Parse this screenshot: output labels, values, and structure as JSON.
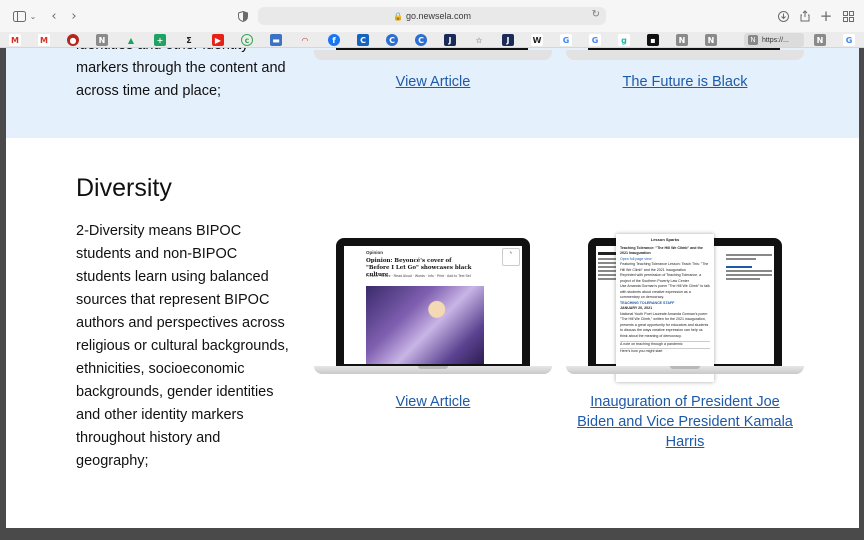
{
  "browser": {
    "url": "go.newsela.com",
    "active_tab_label": "https://..."
  },
  "band": {
    "text": "identities and other identity markers through the content and across time and place;",
    "link_left": "View Article",
    "link_right": "The Future is Black"
  },
  "diversity": {
    "heading": "Diversity",
    "body": "2-Diversity means BIPOC students and non-BIPOC students learn using balanced sources that represent BIPOC authors and perspectives across religious or cultural backgrounds, ethnicities, socioeconomic backgrounds, gender identities and other identity markers throughout history and geography;",
    "link_left": "View Article",
    "link_right": "Inauguration of President Joe Biden and Vice President Kamala Harris"
  },
  "article_preview": {
    "label": "Opinion",
    "title": "Opinion: Beyoncé's cover of \"Before I Let Go\" showcases black culture",
    "tools": "Present · Share · Read Aloud · Words · Info · Print · Add to Text Set"
  },
  "lesson_preview": {
    "panel_title": "Lesson Sparks",
    "headline": "Teaching Tolerance: \"The Hill We Climb\" and the 2021 Inauguration",
    "open_link": "Open full page view",
    "featuring": "Featuring Teaching Tolerance Lesson: Teach This: \"The Hill We Climb\" and the 2021 Inauguration",
    "reprinted": "Reprinted with permission of Teaching Tolerance, a project of the Southern Poverty Law Center",
    "use": "Use Amanda Gorman's poem \"The Hill We Climb\" to talk with students about creative expression as a commentary on democracy.",
    "staff": "TEACHING TOLERANCE STAFF",
    "date": "JANUARY 20, 2021",
    "paragraph": "National Youth Poet Laureate Amanda Gorman's poem \"The Hill We Climb,\" written for the 2021 inauguration, presents a great opportunity for educators and students to discuss the ways creative expression can help us think about the meaning of democracy.",
    "row1": "A note on teaching through a pandemic",
    "row2": "Here's how you might start"
  }
}
